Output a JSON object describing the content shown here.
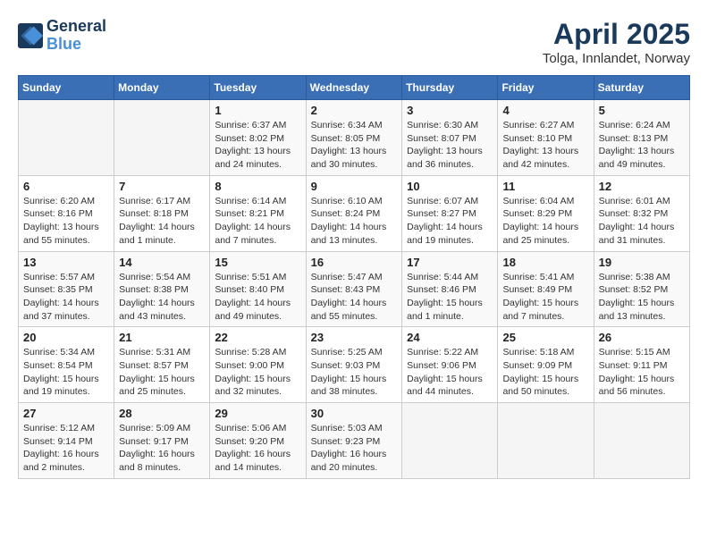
{
  "header": {
    "logo_line1": "General",
    "logo_line2": "Blue",
    "main_title": "April 2025",
    "subtitle": "Tolga, Innlandet, Norway"
  },
  "weekdays": [
    "Sunday",
    "Monday",
    "Tuesday",
    "Wednesday",
    "Thursday",
    "Friday",
    "Saturday"
  ],
  "weeks": [
    [
      {
        "day": "",
        "info": ""
      },
      {
        "day": "",
        "info": ""
      },
      {
        "day": "1",
        "info": "Sunrise: 6:37 AM\nSunset: 8:02 PM\nDaylight: 13 hours and 24 minutes."
      },
      {
        "day": "2",
        "info": "Sunrise: 6:34 AM\nSunset: 8:05 PM\nDaylight: 13 hours and 30 minutes."
      },
      {
        "day": "3",
        "info": "Sunrise: 6:30 AM\nSunset: 8:07 PM\nDaylight: 13 hours and 36 minutes."
      },
      {
        "day": "4",
        "info": "Sunrise: 6:27 AM\nSunset: 8:10 PM\nDaylight: 13 hours and 42 minutes."
      },
      {
        "day": "5",
        "info": "Sunrise: 6:24 AM\nSunset: 8:13 PM\nDaylight: 13 hours and 49 minutes."
      }
    ],
    [
      {
        "day": "6",
        "info": "Sunrise: 6:20 AM\nSunset: 8:16 PM\nDaylight: 13 hours and 55 minutes."
      },
      {
        "day": "7",
        "info": "Sunrise: 6:17 AM\nSunset: 8:18 PM\nDaylight: 14 hours and 1 minute."
      },
      {
        "day": "8",
        "info": "Sunrise: 6:14 AM\nSunset: 8:21 PM\nDaylight: 14 hours and 7 minutes."
      },
      {
        "day": "9",
        "info": "Sunrise: 6:10 AM\nSunset: 8:24 PM\nDaylight: 14 hours and 13 minutes."
      },
      {
        "day": "10",
        "info": "Sunrise: 6:07 AM\nSunset: 8:27 PM\nDaylight: 14 hours and 19 minutes."
      },
      {
        "day": "11",
        "info": "Sunrise: 6:04 AM\nSunset: 8:29 PM\nDaylight: 14 hours and 25 minutes."
      },
      {
        "day": "12",
        "info": "Sunrise: 6:01 AM\nSunset: 8:32 PM\nDaylight: 14 hours and 31 minutes."
      }
    ],
    [
      {
        "day": "13",
        "info": "Sunrise: 5:57 AM\nSunset: 8:35 PM\nDaylight: 14 hours and 37 minutes."
      },
      {
        "day": "14",
        "info": "Sunrise: 5:54 AM\nSunset: 8:38 PM\nDaylight: 14 hours and 43 minutes."
      },
      {
        "day": "15",
        "info": "Sunrise: 5:51 AM\nSunset: 8:40 PM\nDaylight: 14 hours and 49 minutes."
      },
      {
        "day": "16",
        "info": "Sunrise: 5:47 AM\nSunset: 8:43 PM\nDaylight: 14 hours and 55 minutes."
      },
      {
        "day": "17",
        "info": "Sunrise: 5:44 AM\nSunset: 8:46 PM\nDaylight: 15 hours and 1 minute."
      },
      {
        "day": "18",
        "info": "Sunrise: 5:41 AM\nSunset: 8:49 PM\nDaylight: 15 hours and 7 minutes."
      },
      {
        "day": "19",
        "info": "Sunrise: 5:38 AM\nSunset: 8:52 PM\nDaylight: 15 hours and 13 minutes."
      }
    ],
    [
      {
        "day": "20",
        "info": "Sunrise: 5:34 AM\nSunset: 8:54 PM\nDaylight: 15 hours and 19 minutes."
      },
      {
        "day": "21",
        "info": "Sunrise: 5:31 AM\nSunset: 8:57 PM\nDaylight: 15 hours and 25 minutes."
      },
      {
        "day": "22",
        "info": "Sunrise: 5:28 AM\nSunset: 9:00 PM\nDaylight: 15 hours and 32 minutes."
      },
      {
        "day": "23",
        "info": "Sunrise: 5:25 AM\nSunset: 9:03 PM\nDaylight: 15 hours and 38 minutes."
      },
      {
        "day": "24",
        "info": "Sunrise: 5:22 AM\nSunset: 9:06 PM\nDaylight: 15 hours and 44 minutes."
      },
      {
        "day": "25",
        "info": "Sunrise: 5:18 AM\nSunset: 9:09 PM\nDaylight: 15 hours and 50 minutes."
      },
      {
        "day": "26",
        "info": "Sunrise: 5:15 AM\nSunset: 9:11 PM\nDaylight: 15 hours and 56 minutes."
      }
    ],
    [
      {
        "day": "27",
        "info": "Sunrise: 5:12 AM\nSunset: 9:14 PM\nDaylight: 16 hours and 2 minutes."
      },
      {
        "day": "28",
        "info": "Sunrise: 5:09 AM\nSunset: 9:17 PM\nDaylight: 16 hours and 8 minutes."
      },
      {
        "day": "29",
        "info": "Sunrise: 5:06 AM\nSunset: 9:20 PM\nDaylight: 16 hours and 14 minutes."
      },
      {
        "day": "30",
        "info": "Sunrise: 5:03 AM\nSunset: 9:23 PM\nDaylight: 16 hours and 20 minutes."
      },
      {
        "day": "",
        "info": ""
      },
      {
        "day": "",
        "info": ""
      },
      {
        "day": "",
        "info": ""
      }
    ]
  ]
}
